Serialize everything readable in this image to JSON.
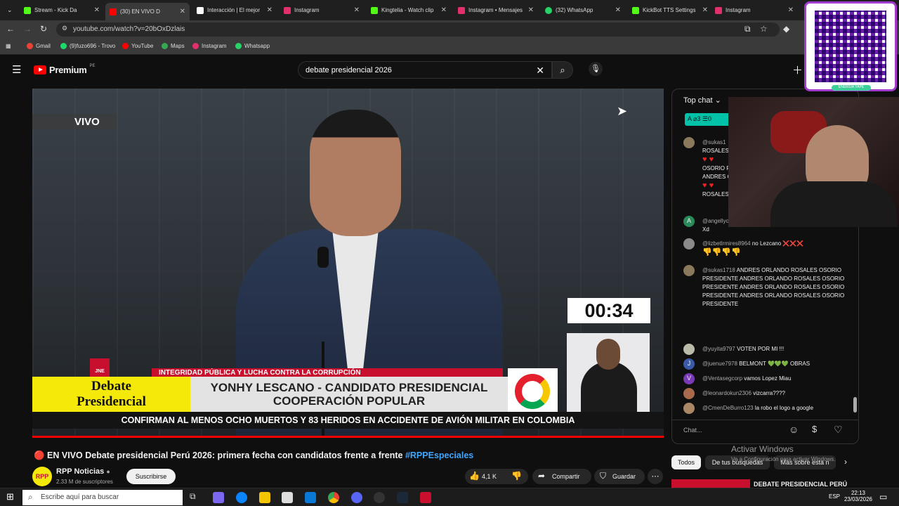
{
  "browser": {
    "tabs": [
      {
        "label": "Stream - Kick Da",
        "color": "#53fc18"
      },
      {
        "label": "(30) EN VIVO D",
        "color": "#ff0000"
      },
      {
        "label": "Interacción | El mejor",
        "color": "#ffffff"
      },
      {
        "label": "Instagram",
        "color": "#e1306c"
      },
      {
        "label": "Kingtelia - Watch clip",
        "color": "#53fc18"
      },
      {
        "label": "Instagram • Mensajes",
        "color": "#e1306c"
      },
      {
        "label": "(32) WhatsApp",
        "color": "#25d366"
      },
      {
        "label": "KickBot TTS Settings",
        "color": "#53fc18"
      },
      {
        "label": "Instagram",
        "color": "#e1306c"
      }
    ],
    "url": "youtube.com/watch?v=20bOxDzlais",
    "bookmarks": [
      "Gmail",
      "(9)fuzo696 - Trovo",
      "YouTube",
      "Maps",
      "Instagram",
      "Whatsapp"
    ]
  },
  "youtube": {
    "logo": "Premium",
    "logo_sup": "PE",
    "search_value": "debate presidencial 2026",
    "video": {
      "live_badge": "VIVO",
      "timer": "00:34",
      "lower_third_left": "Debate Presidencial",
      "ticker_red": "INTEGRIDAD PÚBLICA Y LUCHA CONTRA LA CORRUPCIÓN",
      "candidate_line1": "YONHY LESCANO - CANDIDATO PRESIDENCIAL",
      "candidate_line2": "COOPERACIÓN POPULAR",
      "headline": "CONFIRMAN AL MENOS OCHO MUERTOS Y 83 HERIDOS EN ACCIDENTE DE AVIÓN MILITAR EN COLOMBIA",
      "jne": "JNE"
    },
    "title": "🔴 EN VIVO Debate presidencial Perú 2026: primera fecha con candidatos frente a frente",
    "title_hashtag": "#RPPEspeciales",
    "channel": {
      "name": "RPP Noticias",
      "subs": "2.33 M de suscriptores",
      "subscribe": "Suscribirse",
      "avatar": "RPP"
    },
    "actions": {
      "likes": "4,1 K",
      "share": "Compartir",
      "save": "Guardar"
    },
    "chat": {
      "header": "Top chat",
      "input_placeholder": "Chat...",
      "messages": [
        {
          "user": "@sukas1",
          "text": "ROSALES"
        },
        {
          "user": "",
          "text": "OSORIO P"
        },
        {
          "user": "",
          "text": "ANDRES O"
        },
        {
          "user": "",
          "text": "ROSALES"
        },
        {
          "user": "@angellyo",
          "text": "Xd"
        },
        {
          "user": "@lizbetlrmires8964",
          "text": "no Lezcano ❌❌❌"
        },
        {
          "user": "@sukas1718",
          "text": "ANDRES ORLANDO ROSALES OSORIO PRESIDENTE ANDRES ORLANDO ROSALES OSORIO PRESIDENTE ANDRES ORLANDO ROSALES OSORIO PRESIDENTE ANDRES ORLANDO ROSALES OSORIO PRESIDENTE"
        },
        {
          "user": "@yuyita9797",
          "text": "VOTEN POR MI !!!"
        },
        {
          "user": "@juenue7978",
          "text": "BELMONT 💚💚💚 OBRAS"
        },
        {
          "user": "@Ventasegcorp",
          "text": "vamos Lopez Miau"
        },
        {
          "user": "@leonardokun2306",
          "text": "vizcarra????"
        },
        {
          "user": "@CmenDeBurro123",
          "text": "la robo el logo a google"
        }
      ]
    },
    "chips": [
      "Todos",
      "De tus búsquedas",
      "Más sobre esta n"
    ],
    "related_title": "DEBATE PRESIDENCIAL PERÚ",
    "activate_windows": "Activar Windows",
    "activate_windows_sub": "Ve a Configuración para activar Windows."
  },
  "taskbar": {
    "search_placeholder": "Escribe aquí para buscar",
    "time": "22:13",
    "date": "23/03/2026",
    "lang": "ESP"
  },
  "qr_caption": "ENERGÍA YAPE"
}
